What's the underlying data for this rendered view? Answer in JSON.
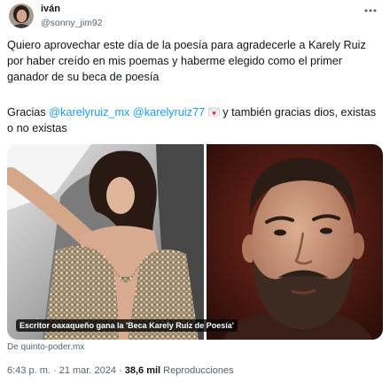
{
  "colors": {
    "text": "#0f1419",
    "secondary": "#536471",
    "link": "#1d9bf0",
    "background": "#ffffff"
  },
  "header": {
    "name": "iván",
    "handle": "@sonny_jim92",
    "more_icon": "more-horizontal-icon"
  },
  "tweet": {
    "paragraph1": [
      "Quiero aprovechar este día de la poesía para agradecerle a Karely Ruiz",
      "por haber creído en mis poemas y haberme elegido como el primer",
      "ganador de su beca de poesía"
    ],
    "paragraph2": {
      "prefix": "Gracias",
      "mentions": [
        "@karelyruiz_mx",
        "@karelyruiz77"
      ],
      "emoji_icon": "love-letter-emoji-icon",
      "suffix": "y también gracias dios, existas",
      "continuation": "o no existas"
    }
  },
  "link_card": {
    "image_caption": "Escritor oaxaqueño gana la 'Beca Karely Ruiz de Poesía'",
    "source": "De quinto-poder.mx"
  },
  "footer": {
    "time": "6:43 p. m.",
    "separator": "·",
    "date": "21 mar. 2024",
    "views_count": "38,6 mil",
    "views_label": "Reproducciones"
  }
}
